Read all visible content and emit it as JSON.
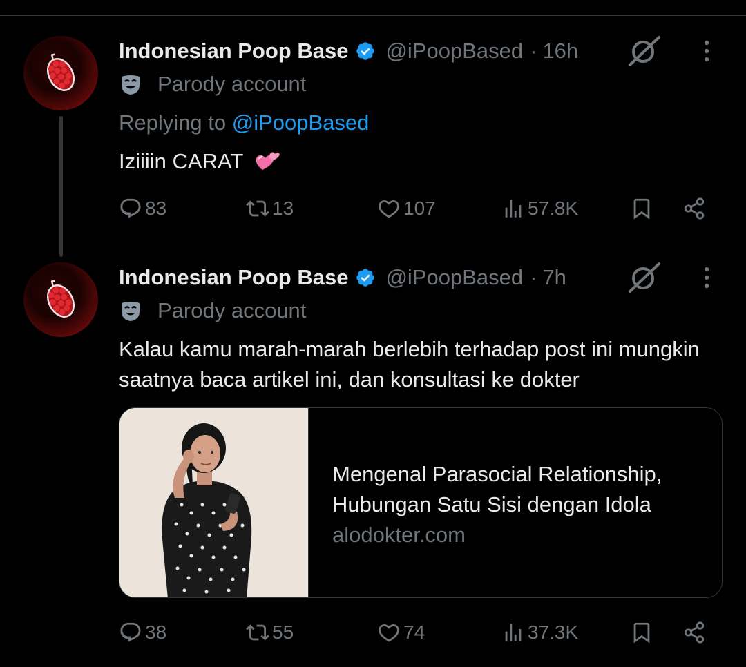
{
  "tweets": [
    {
      "author": {
        "name": "Indonesian Poop Base",
        "handle": "@iPoopBased",
        "verified": true,
        "label": "Parody account"
      },
      "time": "16h",
      "replying_prefix": "Replying to",
      "replying_to": "@iPoopBased",
      "text": "Iziiiin CARAT",
      "text_emoji": "revolving-hearts-emoji",
      "stats": {
        "replies": "83",
        "reposts": "13",
        "likes": "107",
        "views": "57.8K"
      }
    },
    {
      "author": {
        "name": "Indonesian Poop Base",
        "handle": "@iPoopBased",
        "verified": true,
        "label": "Parody account"
      },
      "time": "7h",
      "text": "Kalau kamu marah-marah berlebih terhadap post ini mungkin saatnya baca artikel ini, dan konsultasi ke dokter",
      "card": {
        "title": "Mengenal Parasocial Relationship, Hubungan Satu Sisi dengan Idola",
        "domain": "alodokter.com"
      },
      "stats": {
        "replies": "38",
        "reposts": "55",
        "likes": "74",
        "views": "37.3K"
      }
    }
  ],
  "separator": "·",
  "colors": {
    "background": "#000000",
    "primary_text": "#e7e9ea",
    "secondary_text": "#71767b",
    "link": "#1d9bf0",
    "verified": "#1d9bf0",
    "border": "#2f3336"
  },
  "icons": [
    "reply-icon",
    "repost-icon",
    "like-icon",
    "views-icon",
    "bookmark-icon",
    "share-icon",
    "grok-icon",
    "more-icon",
    "verified-badge-icon",
    "parody-mask-icon"
  ]
}
